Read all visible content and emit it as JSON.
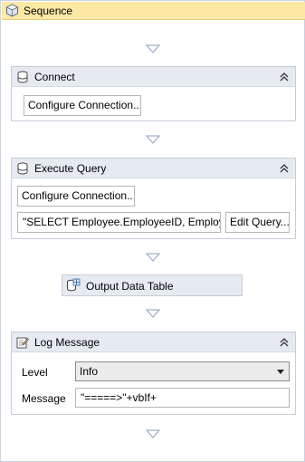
{
  "sequence": {
    "title": "Sequence",
    "icon": "sequence-icon"
  },
  "connect": {
    "title": "Connect",
    "icon": "database-icon",
    "configure_button": "Configure Connection..."
  },
  "execute_query": {
    "title": "Execute Query",
    "icon": "database-icon",
    "configure_button": "Configure Connection...",
    "query_value": "\"SELECT Employee.EmployeeID, Employe",
    "edit_query_button": "Edit Query..."
  },
  "output_data_table": {
    "label": "Output Data Table",
    "icon": "data-table-icon"
  },
  "log_message": {
    "title": "Log Message",
    "icon": "log-message-icon",
    "level_label": "Level",
    "level_value": "Info",
    "message_label": "Message",
    "message_value": "\"=====>\"+vbIf+"
  },
  "colors": {
    "sequence_header": "#fde9a6",
    "activity_header": "#e6ebf2",
    "border": "#c7ced8"
  }
}
